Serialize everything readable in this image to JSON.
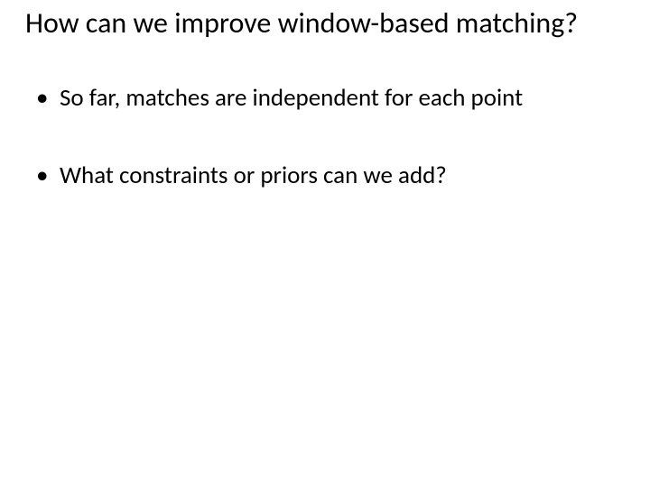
{
  "slide": {
    "title": "How can we improve window-based matching?",
    "bullets": [
      {
        "text": "So far, matches are independent for each point"
      },
      {
        "text": "What constraints or priors can we add?"
      }
    ]
  }
}
